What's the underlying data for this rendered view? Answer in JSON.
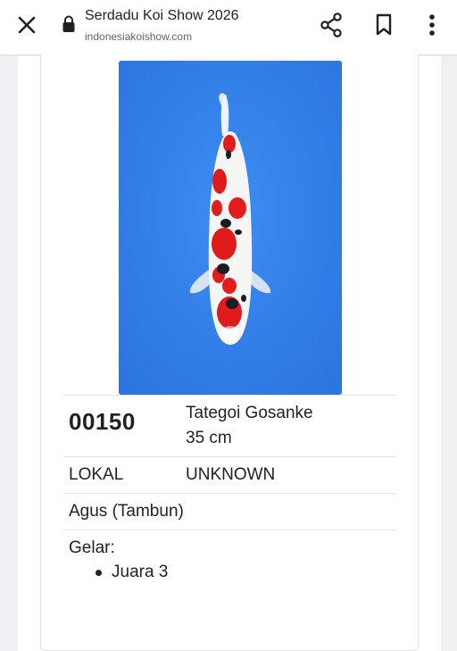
{
  "browser": {
    "title": "Serdadu Koi Show 2026",
    "url": "indonesiakoishow.com",
    "icons": [
      "close-icon",
      "lock-icon",
      "share-icon",
      "bookmark-icon",
      "more-vert-icon"
    ]
  },
  "entry": {
    "number": "00150",
    "variety": "Tategoi Gosanke",
    "size": "35 cm",
    "origin": "LOKAL",
    "breeder": "UNKNOWN",
    "owner": "Agus (Tambun)",
    "title_label": "Gelar:",
    "awards": [
      "Juara 3"
    ]
  },
  "colors": {
    "photo_background": "#3383ec",
    "koi_red": "#e11d1d",
    "koi_black": "#1a1a22",
    "koi_white": "#f6f6f6"
  }
}
